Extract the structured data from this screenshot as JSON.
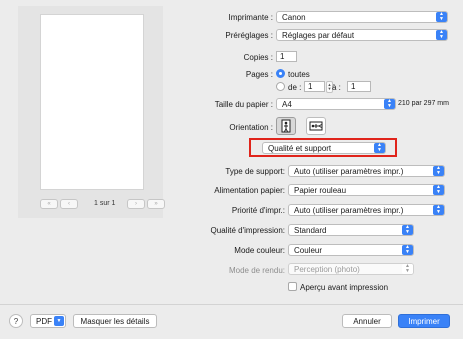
{
  "preview": {
    "page_counter": "1 sur 1"
  },
  "printer": {
    "label": "Imprimante :",
    "value": "Canon"
  },
  "presets": {
    "label": "Préréglages :",
    "value": "Réglages par défaut"
  },
  "copies": {
    "label": "Copies :",
    "value": "1"
  },
  "pages": {
    "label": "Pages :",
    "all_label": "toutes",
    "from_label": "de :",
    "from_value": "1",
    "to_label": "à :",
    "to_value": "1"
  },
  "paper_size": {
    "label": "Taille du papier :",
    "value": "A4",
    "dimensions": "210 par 297 mm"
  },
  "orientation": {
    "label": "Orientation :"
  },
  "section": {
    "value": "Qualité et support"
  },
  "media_type": {
    "label": "Type de support:",
    "value": "Auto (utiliser paramètres impr.)"
  },
  "paper_source": {
    "label": "Alimentation papier:",
    "value": "Papier rouleau"
  },
  "print_priority": {
    "label": "Priorité d'impr.:",
    "value": "Auto (utiliser paramètres impr.)"
  },
  "print_quality": {
    "label": "Qualité d'impression:",
    "value": "Standard"
  },
  "color_mode": {
    "label": "Mode couleur:",
    "value": "Couleur"
  },
  "render_mode": {
    "label": "Mode de rendu:",
    "value": "Perception (photo)"
  },
  "preview_check": {
    "label": "Aperçu avant impression"
  },
  "footer": {
    "help": "?",
    "pdf": "PDF",
    "hide_details": "Masquer les détails",
    "cancel": "Annuler",
    "print": "Imprimer"
  },
  "colors": {
    "accent": "#3a82f7",
    "highlight_border": "#e0241b"
  }
}
